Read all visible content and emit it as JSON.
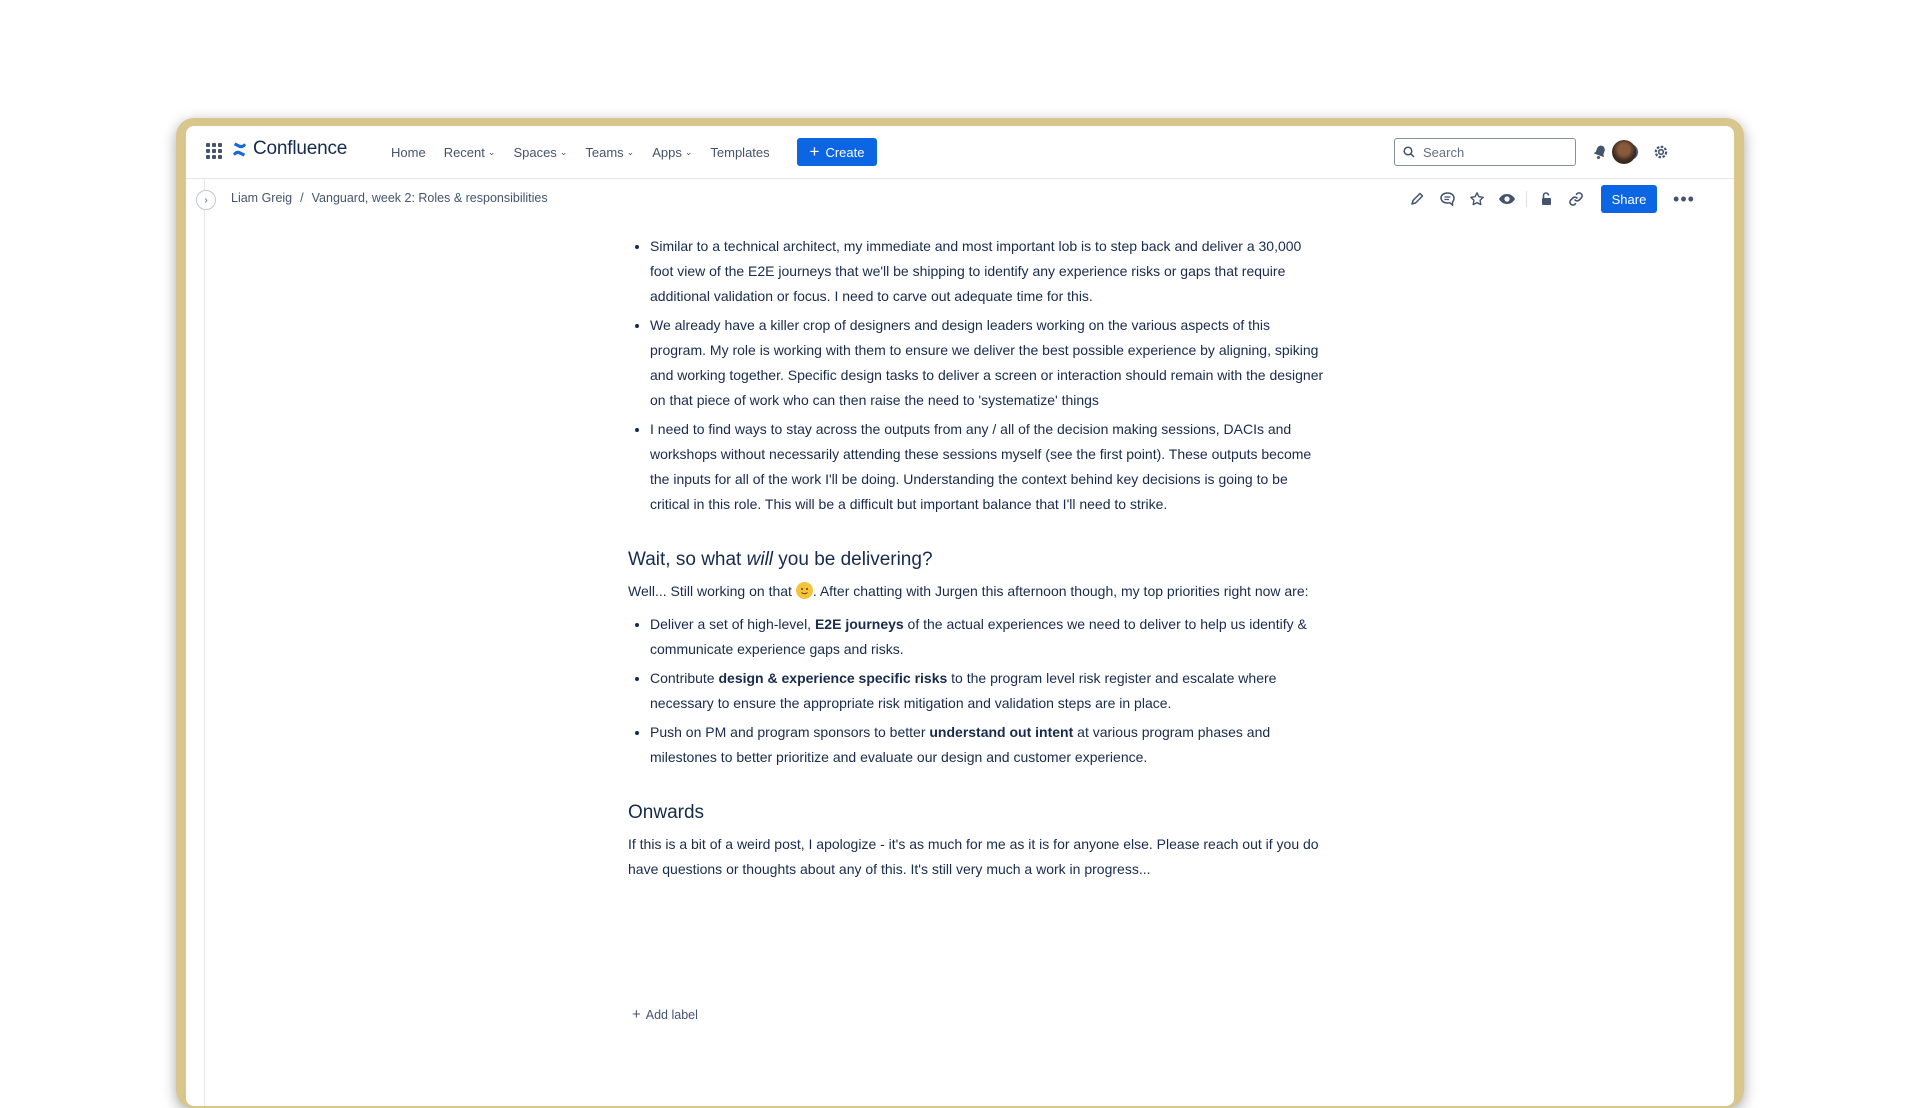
{
  "app": {
    "name": "Confluence"
  },
  "nav": {
    "items": [
      {
        "label": "Home",
        "dropdown": false
      },
      {
        "label": "Recent",
        "dropdown": true
      },
      {
        "label": "Spaces",
        "dropdown": true
      },
      {
        "label": "Teams",
        "dropdown": true
      },
      {
        "label": "Apps",
        "dropdown": true
      },
      {
        "label": "Templates",
        "dropdown": false
      }
    ],
    "create_label": "Create",
    "search_placeholder": "Search",
    "icons": [
      "notifications-icon",
      "help-icon",
      "settings-icon"
    ]
  },
  "breadcrumb": {
    "items": [
      "Liam Greig",
      "Vanguard, week 2: Roles & responsibilities"
    ],
    "separator": "/"
  },
  "page_actions": {
    "icons": [
      "edit-icon",
      "comment-icon",
      "star-icon",
      "watch-icon",
      "restrictions-icon",
      "copy-link-icon"
    ],
    "share_label": "Share",
    "more_label": "•••"
  },
  "content": {
    "bullets1": [
      "Similar to a technical architect, my immediate and most important lob is to step back and deliver a 30,000 foot view of the E2E journeys that we'll be shipping to identify any experience risks or gaps that require additional validation or focus. I need to carve out adequate time for this.",
      "We already have a killer crop of designers and design leaders working on the various aspects of this program. My role is working with them to ensure we deliver the best possible experience by aligning, spiking and working together. Specific design tasks to deliver a screen or interaction should remain with the designer on that piece of work who can then raise the need to 'systematize' things",
      "I need to find ways to stay across the outputs from any / all of the decision making sessions, DACIs and workshops without necessarily attending these sessions myself (see the first point). These outputs become the inputs for all of the work I'll be doing. Understanding the context behind key decisions is going to be critical in this role. This will be a difficult but important balance that I'll need to strike."
    ],
    "heading1": {
      "before": "Wait, so what ",
      "em": "will",
      "after": " you be delivering?"
    },
    "para1": {
      "before": "Well... Still working on that ",
      "after": ". After chatting with Jurgen this afternoon though, my top priorities right now are:"
    },
    "bullets2": [
      {
        "before": "Deliver a set of high-level, ",
        "bold": "E2E journeys",
        "after": " of the actual experiences we need to deliver to help us identify & communicate experience gaps and risks."
      },
      {
        "before": "Contribute ",
        "bold": "design & experience specific risks",
        "after": " to the program level risk register and escalate where necessary to ensure the appropriate risk mitigation and validation steps are in place."
      },
      {
        "before": "Push on PM and program sponsors to better ",
        "bold": "understand out intent",
        "after": " at various program phases and milestones to better prioritize and evaluate our design and customer experience."
      }
    ],
    "heading2": "Onwards",
    "para2": "If this is a bit of a weird post, I apologize - it's as much for me as it is for anyone else. Please reach out if you do have questions or thoughts about any of this. It's still very much a work in progress...",
    "add_label": "Add label"
  },
  "colors": {
    "brand": "#0C66E4",
    "text": "#172B4D",
    "subtle": "#44546F",
    "frame": "#d9c68c"
  }
}
